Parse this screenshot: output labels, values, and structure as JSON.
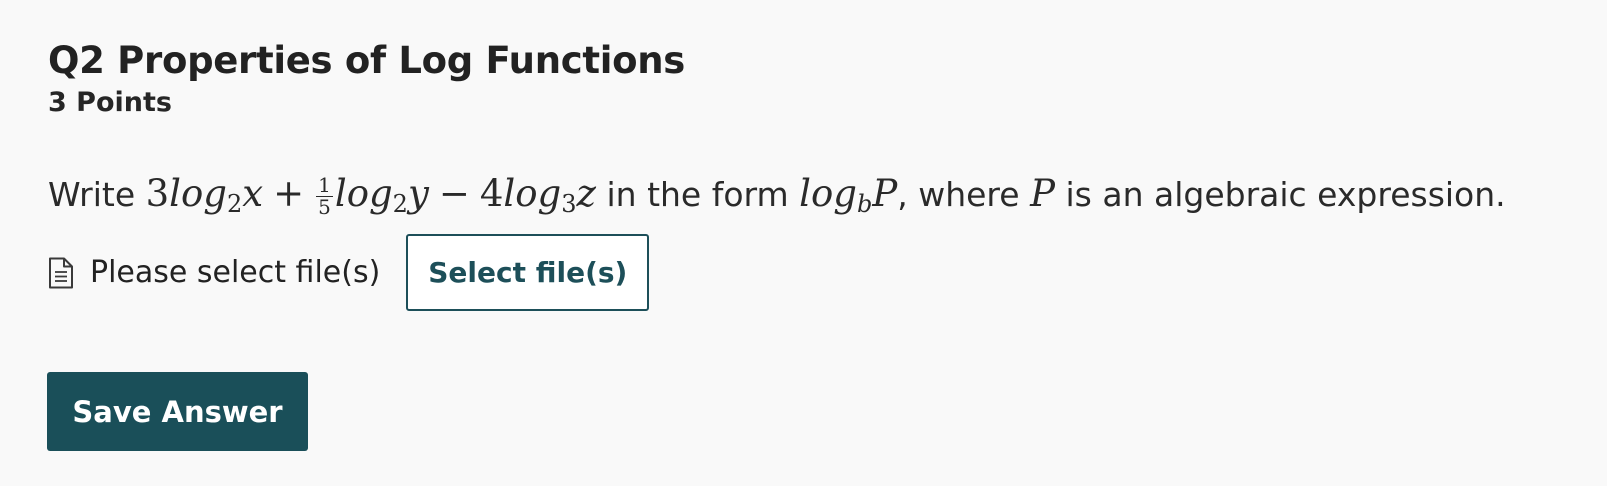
{
  "question": {
    "title": "Q2 Properties of Log Functions",
    "points": "3 Points",
    "prompt": {
      "write": "Write",
      "in_the_form": "in the form",
      "where": ", where",
      "rest": "is an algebraic expression.",
      "expr": {
        "coef1": "3",
        "log": "log",
        "base1": "2",
        "var1": "x",
        "plus": "+",
        "frac_num": "1",
        "frac_den": "5",
        "base2": "2",
        "var2": "y",
        "minus": "−",
        "coef3": "4",
        "base3": "3",
        "var3": "z"
      },
      "form": {
        "log": "log",
        "base": "b",
        "arg": "P"
      },
      "where_var": "P"
    }
  },
  "upload": {
    "icon": "document-icon",
    "status_text": "Please select file(s)",
    "select_button_label": "Select file(s)"
  },
  "save_button_label": "Save Answer",
  "colors": {
    "accent": "#1a4f59",
    "background": "#f9f9f9",
    "text": "#262626"
  }
}
